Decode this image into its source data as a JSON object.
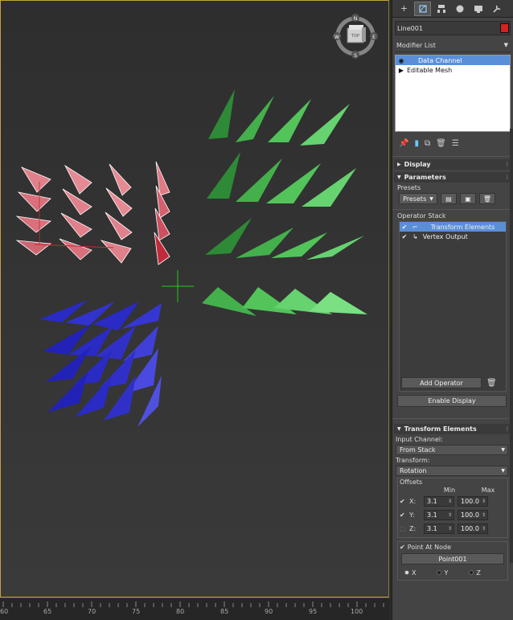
{
  "viewport": {
    "viewcube_face": "TOP",
    "compass": {
      "n": "N",
      "e": "E",
      "s": "S",
      "w": "W"
    }
  },
  "timeline": {
    "labels": [
      "60",
      "65",
      "70",
      "75",
      "80",
      "85",
      "90",
      "95",
      "100"
    ]
  },
  "panel": {
    "tabs": [
      "create-icon",
      "modify-icon",
      "hierarchy-icon",
      "motion-icon",
      "display-icon",
      "utilities-icon"
    ],
    "object_name": "Line001",
    "object_color": "#d42222",
    "modifier_list_label": "Modifier List",
    "stack_items": [
      "Data Channel",
      "Editable Mesh"
    ],
    "rollouts": {
      "display": "Display",
      "parameters": "Parameters",
      "transform_elements": "Transform Elements"
    },
    "presets_label": "Presets",
    "presets_dropdown": "Presets",
    "operator_stack_label": "Operator Stack",
    "operators": [
      "Transform Elements",
      "Vertex Output"
    ],
    "add_operator": "Add Operator",
    "enable_display": "Enable Display",
    "input_channel_label": "Input Channel:",
    "input_channel_value": "From Stack",
    "transform_label": "Transform:",
    "transform_value": "Rotation",
    "offsets_label": "Offsets",
    "min_label": "Min",
    "max_label": "Max",
    "offsets": [
      {
        "axis": "X:",
        "checked": true,
        "min": "3.1",
        "max": "100.0"
      },
      {
        "axis": "Y:",
        "checked": true,
        "min": "3.1",
        "max": "100.0"
      },
      {
        "axis": "Z:",
        "checked": false,
        "min": "3.1",
        "max": "100.0"
      }
    ],
    "point_at_node_label": "Point At Node",
    "point_node_button": "Point001",
    "radio_axes": [
      "X",
      "Y",
      "Z"
    ],
    "radio_selected": "X"
  }
}
